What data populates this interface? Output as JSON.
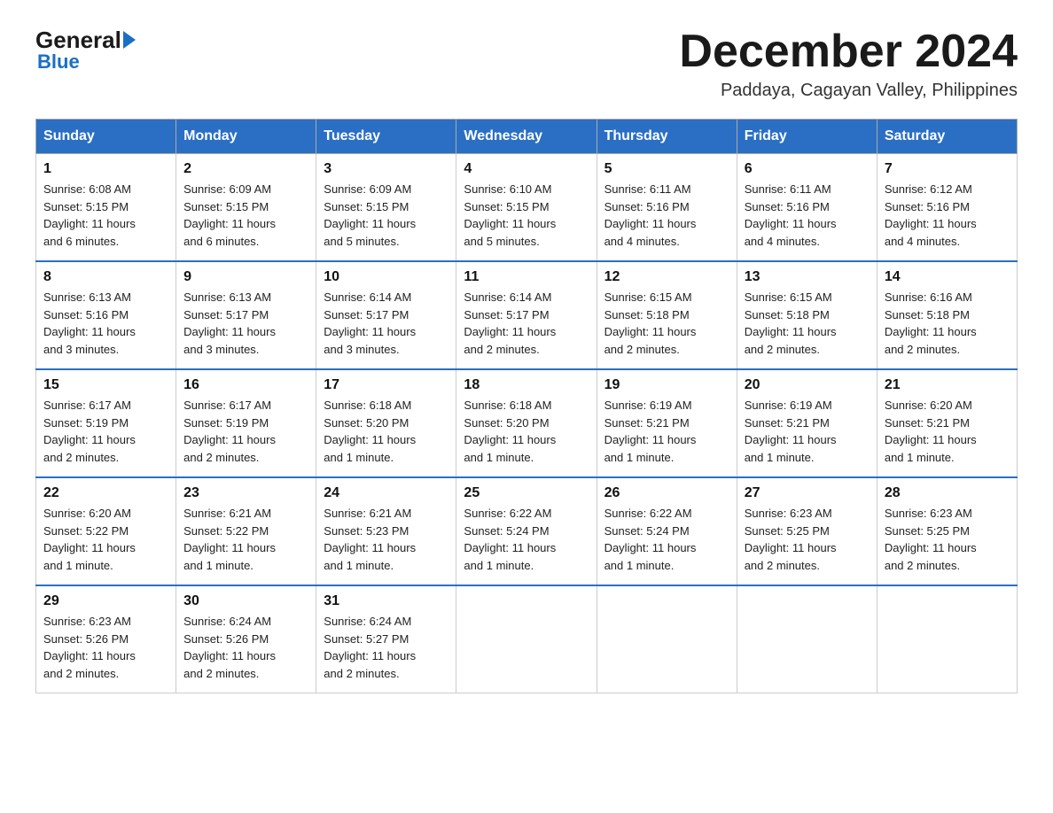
{
  "header": {
    "logo_general": "General",
    "logo_blue": "Blue",
    "month_title": "December 2024",
    "location": "Paddaya, Cagayan Valley, Philippines"
  },
  "weekdays": [
    "Sunday",
    "Monday",
    "Tuesday",
    "Wednesday",
    "Thursday",
    "Friday",
    "Saturday"
  ],
  "weeks": [
    [
      {
        "day": "1",
        "sunrise": "6:08 AM",
        "sunset": "5:15 PM",
        "daylight": "11 hours and 6 minutes."
      },
      {
        "day": "2",
        "sunrise": "6:09 AM",
        "sunset": "5:15 PM",
        "daylight": "11 hours and 6 minutes."
      },
      {
        "day": "3",
        "sunrise": "6:09 AM",
        "sunset": "5:15 PM",
        "daylight": "11 hours and 5 minutes."
      },
      {
        "day": "4",
        "sunrise": "6:10 AM",
        "sunset": "5:15 PM",
        "daylight": "11 hours and 5 minutes."
      },
      {
        "day": "5",
        "sunrise": "6:11 AM",
        "sunset": "5:16 PM",
        "daylight": "11 hours and 4 minutes."
      },
      {
        "day": "6",
        "sunrise": "6:11 AM",
        "sunset": "5:16 PM",
        "daylight": "11 hours and 4 minutes."
      },
      {
        "day": "7",
        "sunrise": "6:12 AM",
        "sunset": "5:16 PM",
        "daylight": "11 hours and 4 minutes."
      }
    ],
    [
      {
        "day": "8",
        "sunrise": "6:13 AM",
        "sunset": "5:16 PM",
        "daylight": "11 hours and 3 minutes."
      },
      {
        "day": "9",
        "sunrise": "6:13 AM",
        "sunset": "5:17 PM",
        "daylight": "11 hours and 3 minutes."
      },
      {
        "day": "10",
        "sunrise": "6:14 AM",
        "sunset": "5:17 PM",
        "daylight": "11 hours and 3 minutes."
      },
      {
        "day": "11",
        "sunrise": "6:14 AM",
        "sunset": "5:17 PM",
        "daylight": "11 hours and 2 minutes."
      },
      {
        "day": "12",
        "sunrise": "6:15 AM",
        "sunset": "5:18 PM",
        "daylight": "11 hours and 2 minutes."
      },
      {
        "day": "13",
        "sunrise": "6:15 AM",
        "sunset": "5:18 PM",
        "daylight": "11 hours and 2 minutes."
      },
      {
        "day": "14",
        "sunrise": "6:16 AM",
        "sunset": "5:18 PM",
        "daylight": "11 hours and 2 minutes."
      }
    ],
    [
      {
        "day": "15",
        "sunrise": "6:17 AM",
        "sunset": "5:19 PM",
        "daylight": "11 hours and 2 minutes."
      },
      {
        "day": "16",
        "sunrise": "6:17 AM",
        "sunset": "5:19 PM",
        "daylight": "11 hours and 2 minutes."
      },
      {
        "day": "17",
        "sunrise": "6:18 AM",
        "sunset": "5:20 PM",
        "daylight": "11 hours and 1 minute."
      },
      {
        "day": "18",
        "sunrise": "6:18 AM",
        "sunset": "5:20 PM",
        "daylight": "11 hours and 1 minute."
      },
      {
        "day": "19",
        "sunrise": "6:19 AM",
        "sunset": "5:21 PM",
        "daylight": "11 hours and 1 minute."
      },
      {
        "day": "20",
        "sunrise": "6:19 AM",
        "sunset": "5:21 PM",
        "daylight": "11 hours and 1 minute."
      },
      {
        "day": "21",
        "sunrise": "6:20 AM",
        "sunset": "5:21 PM",
        "daylight": "11 hours and 1 minute."
      }
    ],
    [
      {
        "day": "22",
        "sunrise": "6:20 AM",
        "sunset": "5:22 PM",
        "daylight": "11 hours and 1 minute."
      },
      {
        "day": "23",
        "sunrise": "6:21 AM",
        "sunset": "5:22 PM",
        "daylight": "11 hours and 1 minute."
      },
      {
        "day": "24",
        "sunrise": "6:21 AM",
        "sunset": "5:23 PM",
        "daylight": "11 hours and 1 minute."
      },
      {
        "day": "25",
        "sunrise": "6:22 AM",
        "sunset": "5:24 PM",
        "daylight": "11 hours and 1 minute."
      },
      {
        "day": "26",
        "sunrise": "6:22 AM",
        "sunset": "5:24 PM",
        "daylight": "11 hours and 1 minute."
      },
      {
        "day": "27",
        "sunrise": "6:23 AM",
        "sunset": "5:25 PM",
        "daylight": "11 hours and 2 minutes."
      },
      {
        "day": "28",
        "sunrise": "6:23 AM",
        "sunset": "5:25 PM",
        "daylight": "11 hours and 2 minutes."
      }
    ],
    [
      {
        "day": "29",
        "sunrise": "6:23 AM",
        "sunset": "5:26 PM",
        "daylight": "11 hours and 2 minutes."
      },
      {
        "day": "30",
        "sunrise": "6:24 AM",
        "sunset": "5:26 PM",
        "daylight": "11 hours and 2 minutes."
      },
      {
        "day": "31",
        "sunrise": "6:24 AM",
        "sunset": "5:27 PM",
        "daylight": "11 hours and 2 minutes."
      },
      null,
      null,
      null,
      null
    ]
  ],
  "labels": {
    "sunrise": "Sunrise:",
    "sunset": "Sunset:",
    "daylight": "Daylight:"
  }
}
